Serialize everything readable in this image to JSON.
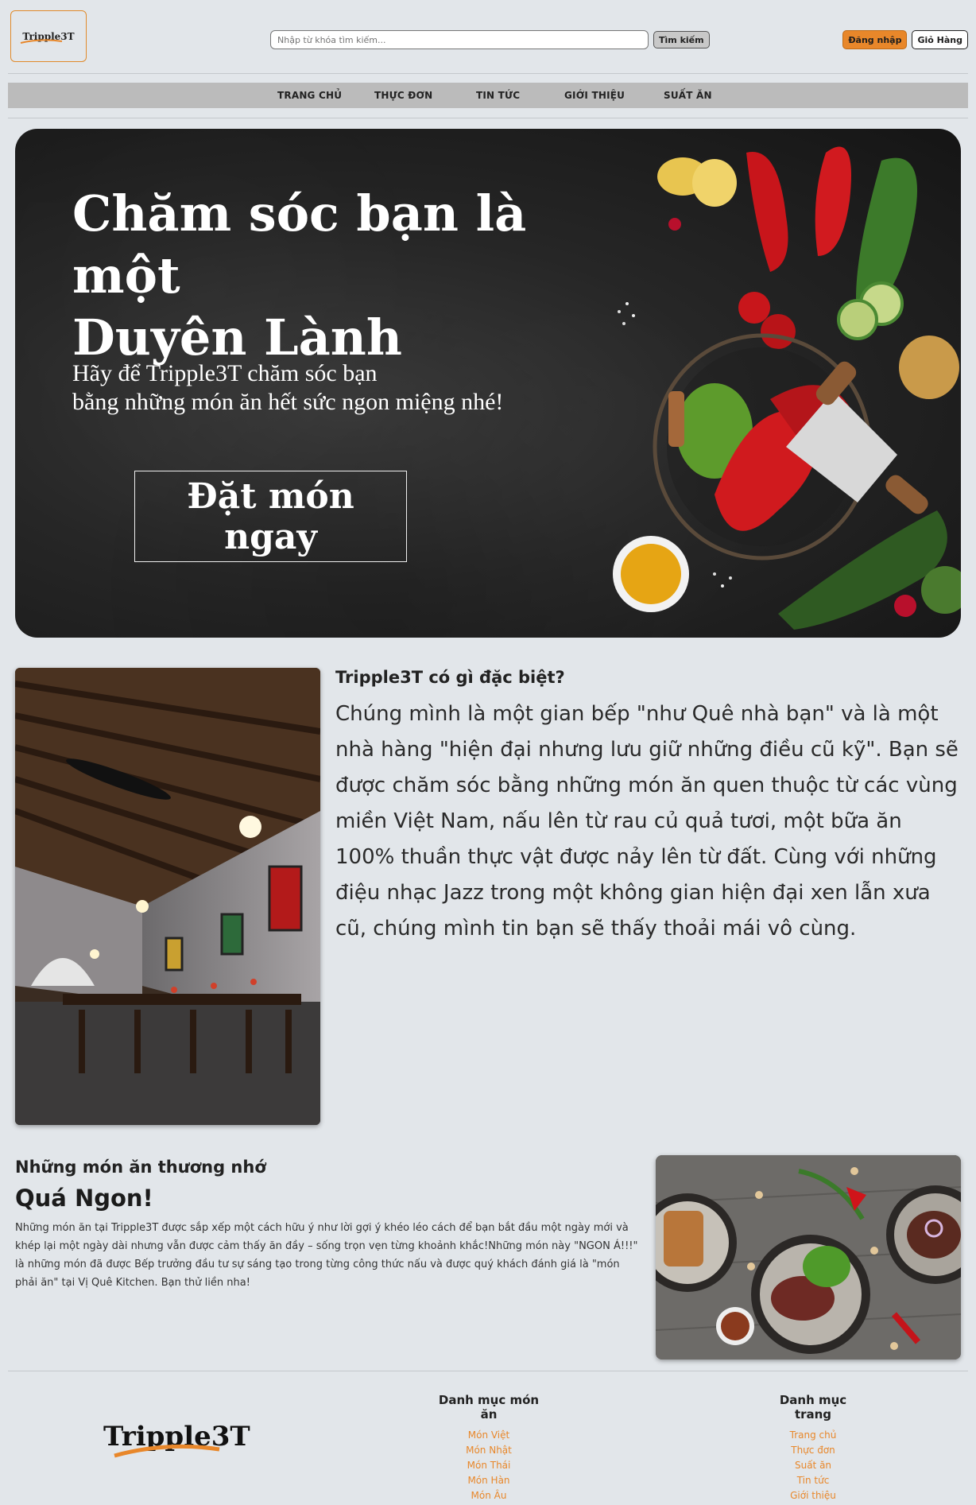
{
  "header": {
    "logo_text": "Tripple3T",
    "search_placeholder": "Nhập từ khóa tìm kiếm...",
    "search_button": "Tìm kiếm",
    "login_button": "Đăng nhập",
    "cart_button": "Giỏ Hàng"
  },
  "nav": {
    "items": [
      "TRANG CHỦ",
      "THỰC ĐƠN",
      "TIN TỨC",
      "GIỚI THIỆU",
      "SUẤT ĂN"
    ]
  },
  "hero": {
    "title_line1": "Chăm sóc bạn là một",
    "title_line2": "Duyên Lành",
    "subtitle_line1": "Hãy để Tripple3T chăm sóc bạn",
    "subtitle_line2": "bằng những món ăn hết sức ngon miệng nhé!",
    "cta": "Đặt món ngay"
  },
  "about": {
    "heading": "Tripple3T có gì đặc biệt?",
    "body": "Chúng mình là một gian bếp \"như Quê nhà bạn\" và là một nhà hàng \"hiện đại nhưng lưu giữ những điều cũ kỹ\". Bạn sẽ được chăm sóc bằng những món ăn quen thuộc từ các vùng miền Việt Nam, nấu lên từ rau củ quả tươi, một bữa ăn 100% thuần thực vật được nảy lên từ đất. Cùng với những điệu nhạc Jazz trong một không gian hiện đại xen lẫn xưa cũ, chúng mình tin bạn sẽ thấy thoải mái vô cùng."
  },
  "dishes": {
    "heading": "Những món ăn thương nhớ",
    "title": "Quá Ngon!",
    "body": "Những món ăn tại Tripple3T được sắp xếp một cách hữu ý như lời gợi ý khéo léo cách để bạn bắt đầu một ngày mới và khép lại một ngày dài nhưng vẫn được cảm thấy ăn đầy – sống trọn vẹn từng khoảnh khắc!Những món này \"NGON Á!!!\" là những món đã được Bếp trưởng đầu tư sự sáng tạo trong từng công thức nấu và được quý khách đánh giá là \"món phải ăn\" tại Vị Quê Kitchen. Bạn thử liền nha!"
  },
  "footer": {
    "logo_text": "Tripple3T",
    "col1": {
      "title": "Danh mục món ăn",
      "links": [
        "Món Việt",
        "Món Nhật",
        "Món Thái",
        "Món Hàn",
        "Món Âu"
      ]
    },
    "col2": {
      "title": "Danh mục trang",
      "links": [
        "Trang chủ",
        "Thực đơn",
        "Suất ăn",
        "Tin tức",
        "Giới thiệu"
      ]
    }
  },
  "colors": {
    "accent": "#e8872a",
    "background": "#e2e6ea",
    "nav_bg": "#bbbbbb"
  }
}
